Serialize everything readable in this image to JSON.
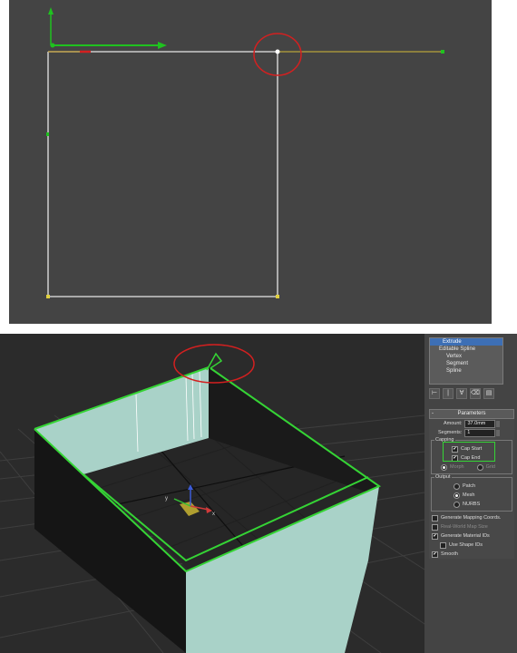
{
  "modifier_stack": {
    "items": [
      "Extrude",
      "Editable Spline",
      "Vertex",
      "Segment",
      "Spline"
    ]
  },
  "toolbar_icons": [
    "pin-stack-icon",
    "show-end-result-icon",
    "make-unique-icon",
    "remove-modifier-icon",
    "configure-sets-icon"
  ],
  "parameters": {
    "title": "Parameters",
    "minus": "-",
    "amount_label": "Amount:",
    "amount_value": "37.0mm",
    "segments_label": "Segments:",
    "segments_value": "1",
    "capping_label": "Capping",
    "cap_start_label": "Cap Start",
    "cap_end_label": "Cap End",
    "morph_label": "Morph",
    "grid_label": "Grid",
    "output_label": "Output",
    "patch_label": "Patch",
    "mesh_label": "Mesh",
    "nurbs_label": "NURBS",
    "gen_mapping_label": "Generate Mapping Coords.",
    "real_world_label": "Real-World Map Size",
    "gen_material_label": "Generate Material IDs",
    "use_shape_label": "Use Shape IDs",
    "smooth_label": "Smooth"
  },
  "state": {
    "cap_start": true,
    "cap_end": true,
    "output": "Mesh",
    "gen_mapping": false,
    "real_world": false,
    "gen_material": true,
    "use_shape": false,
    "smooth": true
  },
  "colors": {
    "viewport_bg": "#444444",
    "spline_white": "#e6e6e6",
    "highlight_red": "#d32020",
    "selection_green": "#35d435",
    "wall_face": "#a9d2c8"
  }
}
